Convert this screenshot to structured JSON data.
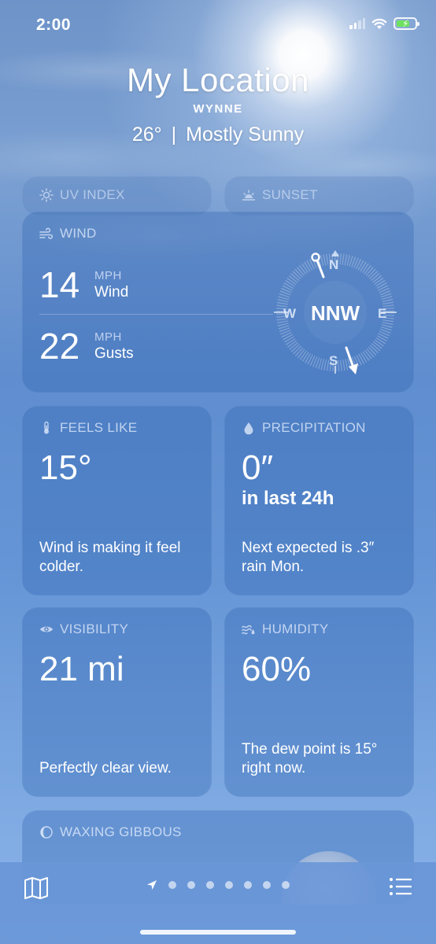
{
  "status": {
    "time": "2:00"
  },
  "header": {
    "title": "My Location",
    "subtitle": "WYNNE",
    "temp": "26°",
    "separator": "|",
    "condition": "Mostly Sunny"
  },
  "peek_cards": [
    {
      "label": "UV INDEX",
      "icon": "sun-icon"
    },
    {
      "label": "SUNSET",
      "icon": "sunset-icon"
    }
  ],
  "wind": {
    "label": "WIND",
    "icon": "wind-icon",
    "speed": {
      "value": "14",
      "unit": "MPH",
      "label": "Wind"
    },
    "gusts": {
      "value": "22",
      "unit": "MPH",
      "label": "Gusts"
    },
    "compass": {
      "direction": "NNW",
      "n": "N",
      "e": "E",
      "s": "S",
      "w": "W"
    }
  },
  "feels_like": {
    "label": "FEELS LIKE",
    "icon": "thermometer-icon",
    "value": "15°",
    "description": "Wind is making it feel colder."
  },
  "precipitation": {
    "label": "PRECIPITATION",
    "icon": "raindrop-icon",
    "value": "0″",
    "sub": "in last 24h",
    "description": "Next expected is .3″ rain Mon."
  },
  "visibility": {
    "label": "VISIBILITY",
    "icon": "eye-icon",
    "value": "21 mi",
    "description": "Perfectly clear view."
  },
  "humidity": {
    "label": "HUMIDITY",
    "icon": "humidity-icon",
    "value": "60%",
    "description": "The dew point is 15° right now."
  },
  "moon": {
    "label": "WAXING GIBBOUS",
    "icon": "moon-phase-icon"
  },
  "tabbar": {
    "left_icon": "map-icon",
    "right_icon": "list-icon",
    "page_count": 7,
    "current": "location-arrow-icon"
  },
  "colors": {
    "battery": "#6ee25f"
  }
}
